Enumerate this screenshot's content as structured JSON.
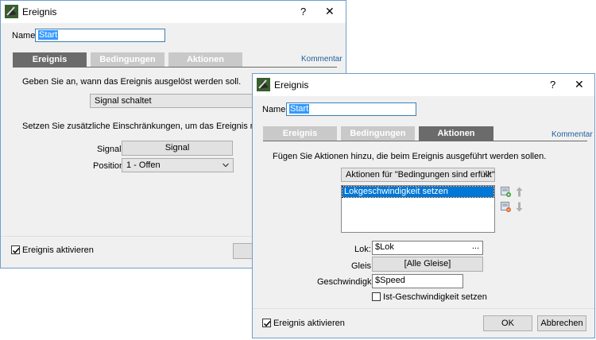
{
  "back_window": {
    "title": "Ereignis",
    "help": "?",
    "close": "✕",
    "name_label": "Name:",
    "name_value": "Start",
    "tabs": [
      "Ereignis",
      "Bedingungen",
      "Aktionen"
    ],
    "comment_link": "Kommentar",
    "description": "Geben Sie an, wann das Ereignis ausgelöst werden soll.",
    "trigger_value": "Signal schaltet",
    "restriction_text": "Setzen Sie zusätzliche Einschränkungen, um das Ereignis nur in bestimmten Si",
    "signal_label": "Signal:",
    "signal_button": "Signal",
    "position_label": "Position:",
    "position_value": "1 - Offen",
    "activate_label": "Ereignis aktivieren"
  },
  "front_window": {
    "title": "Ereignis",
    "help": "?",
    "close": "✕",
    "name_label": "Name:",
    "name_value": "Start",
    "tabs": [
      "Ereignis",
      "Bedingungen",
      "Aktionen"
    ],
    "comment_link": "Kommentar",
    "description": "Fügen Sie Aktionen hinzu, die beim Ereignis ausgeführt werden sollen.",
    "actions_combo": "Aktionen für \"Bedingungen sind erfüllt\"",
    "actions_list": [
      "Lokgeschwindigkeit setzen"
    ],
    "lok_label": "Lok:",
    "lok_value": "$Lok",
    "lok_browse": "...",
    "gleis_label": "Gleis:",
    "gleis_value": "[Alle Gleise]",
    "speed_label": "Geschwindigkeit:",
    "speed_value": "$Speed",
    "actual_speed_label": "Ist-Geschwindigkeit setzen",
    "activate_label": "Ereignis aktivieren",
    "ok_button": "OK",
    "cancel_button": "Abbrechen"
  },
  "colors": {
    "active_tab": "#6b6b6b",
    "inactive_tab": "#c9c9c9",
    "link": "#1e5f9e",
    "selection": "#0078d7"
  }
}
